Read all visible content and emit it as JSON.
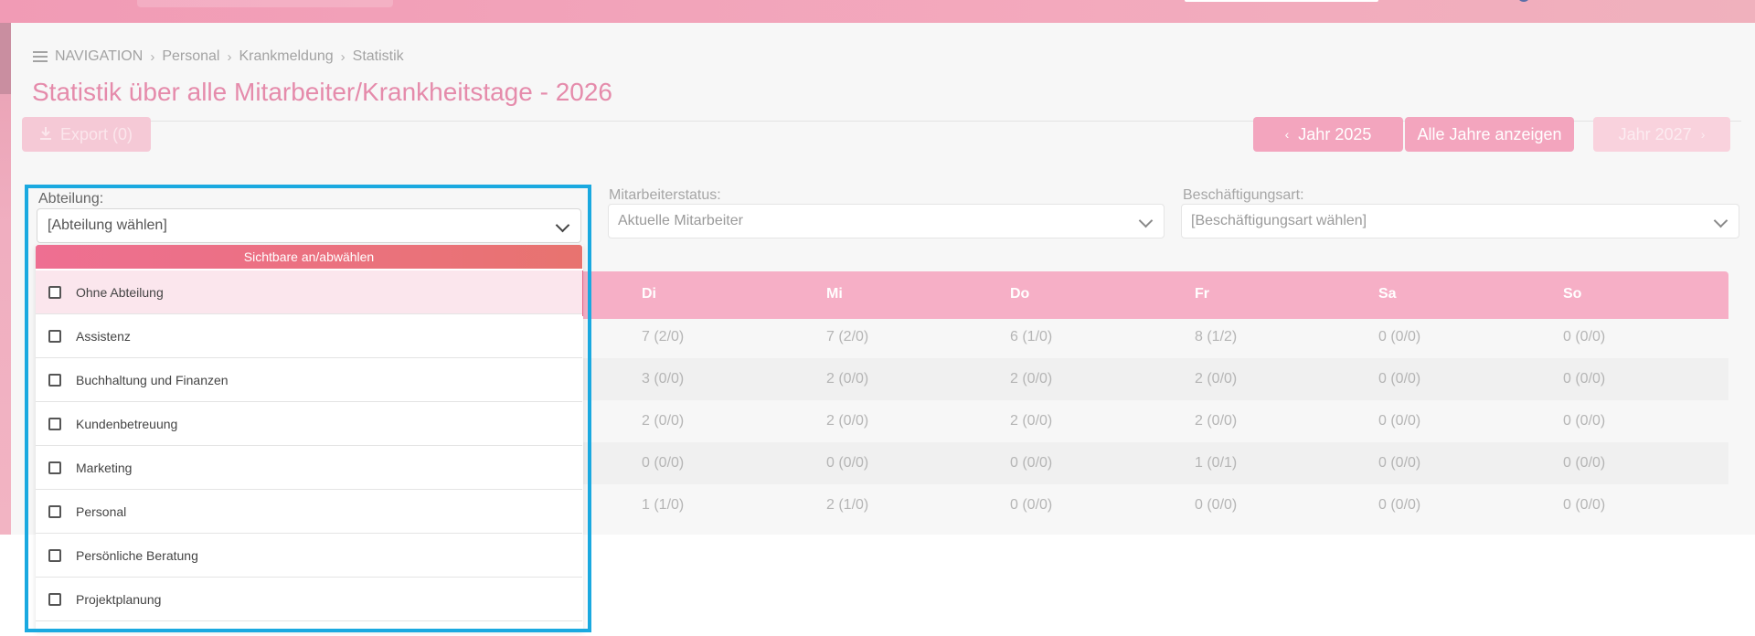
{
  "breadcrumb": {
    "items": [
      "NAVIGATION",
      "Personal",
      "Krankmeldung",
      "Statistik"
    ]
  },
  "page_title": "Statistik über alle Mitarbeiter/Krankheitstage - 2026",
  "toolbar": {
    "export_label": "Export (0)",
    "prev_year_label": "Jahr 2025",
    "all_years_label": "Alle Jahre anzeigen",
    "next_year_label": "Jahr 2027"
  },
  "filters": {
    "abteilung": {
      "label": "Abteilung:",
      "value": "[Abteilung wählen]",
      "toggle_label": "Sichtbare an/abwählen",
      "options": [
        "Ohne Abteilung",
        "Assistenz",
        "Buchhaltung und Finanzen",
        "Kundenbetreuung",
        "Marketing",
        "Personal",
        "Persönliche Beratung",
        "Projektplanung"
      ]
    },
    "mitarbeiterstatus": {
      "label": "Mitarbeiterstatus:",
      "value": "Aktuelle Mitarbeiter"
    },
    "beschaeftigungsart": {
      "label": "Beschäftigungsart:",
      "value": "[Beschäftigungsart wählen]"
    }
  },
  "table": {
    "columns": [
      "Di",
      "Mi",
      "Do",
      "Fr",
      "Sa",
      "So"
    ],
    "rows": [
      [
        "7 (2/0)",
        "7 (2/0)",
        "6 (1/0)",
        "8 (1/2)",
        "0 (0/0)",
        "0 (0/0)"
      ],
      [
        "3 (0/0)",
        "2 (0/0)",
        "2 (0/0)",
        "2 (0/0)",
        "0 (0/0)",
        "0 (0/0)"
      ],
      [
        "2 (0/0)",
        "2 (0/0)",
        "2 (0/0)",
        "2 (0/0)",
        "0 (0/0)",
        "0 (0/0)"
      ],
      [
        "0 (0/0)",
        "0 (0/0)",
        "0 (0/0)",
        "1 (0/1)",
        "0 (0/0)",
        "0 (0/0)"
      ],
      [
        "1 (1/0)",
        "2 (1/0)",
        "0 (0/0)",
        "0 (0/0)",
        "0 (0/0)",
        "0 (0/0)"
      ]
    ]
  },
  "icons": {
    "menu": "menu-icon",
    "export": "download-icon",
    "prev": "chevron-left-icon",
    "next": "chevron-right-icon",
    "select": "chevron-down-icon",
    "checkbox": "checkbox-icon"
  },
  "colors": {
    "brand_pink": "#e58bab",
    "header_pink": "#f6afc6",
    "toggle_gradient_start": "#ee6f92",
    "toggle_gradient_end": "#e8736f",
    "highlight_blue": "#1aa9e0"
  }
}
